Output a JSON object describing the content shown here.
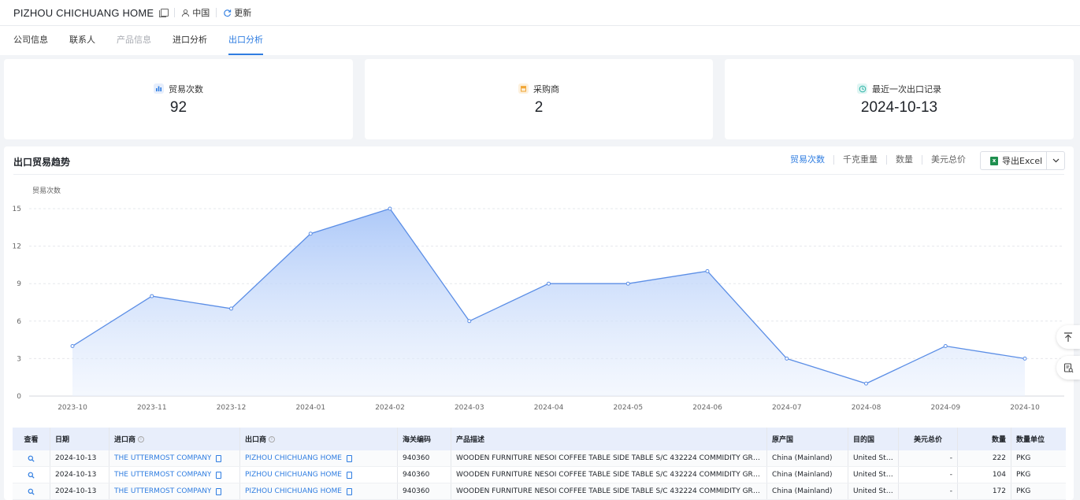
{
  "header": {
    "company_name": "PIZHOU CHICHUANG HOME",
    "region": "中国",
    "refresh_label": "更新"
  },
  "tabs": [
    {
      "label": "公司信息",
      "state": "normal"
    },
    {
      "label": "联系人",
      "state": "normal"
    },
    {
      "label": "产品信息",
      "state": "disabled"
    },
    {
      "label": "进口分析",
      "state": "normal"
    },
    {
      "label": "出口分析",
      "state": "active"
    }
  ],
  "stats": {
    "trade_count_label": "贸易次数",
    "trade_count_value": "92",
    "buyers_label": "采购商",
    "buyers_value": "2",
    "last_export_label": "最近一次出口记录",
    "last_export_value": "2024-10-13"
  },
  "trend_panel": {
    "title": "出口贸易趋势",
    "metrics": [
      "贸易次数",
      "千克重量",
      "数量",
      "美元总价"
    ],
    "active_metric": "贸易次数",
    "export_label": "导出Excel"
  },
  "chart_data": {
    "type": "area",
    "ylabel": "贸易次数",
    "ylim": [
      0,
      15
    ],
    "yticks": [
      0,
      3,
      6,
      9,
      12,
      15
    ],
    "grid": true,
    "categories": [
      "2023-10",
      "2023-11",
      "2023-12",
      "2024-01",
      "2024-02",
      "2024-03",
      "2024-04",
      "2024-05",
      "2024-06",
      "2024-07",
      "2024-08",
      "2024-09",
      "2024-10"
    ],
    "values": [
      4,
      8,
      7,
      13,
      15,
      6,
      9,
      9,
      10,
      3,
      1,
      4,
      3
    ],
    "line_color": "#5b8ee6",
    "fill_color": "#c7d9fb"
  },
  "table": {
    "columns": [
      "查看",
      "日期",
      "进口商",
      "出口商",
      "海关编码",
      "产品描述",
      "原产国",
      "目的国",
      "美元总价",
      "数量",
      "数量单位"
    ],
    "rows": [
      [
        "2024-10-13",
        "THE UTTERMOST COMPANY",
        "PIZHOU CHICHUANG HOME",
        "940360",
        "WOODEN FURNITURE NESOI COFFEE TABLE SIDE TABLE S/C 432224 COMMIDITY GROU...",
        "China (Mainland)",
        "United Stat...",
        "-",
        "222",
        "PKG"
      ],
      [
        "2024-10-13",
        "THE UTTERMOST COMPANY",
        "PIZHOU CHICHUANG HOME",
        "940360",
        "WOODEN FURNITURE NESOI COFFEE TABLE SIDE TABLE S/C 432224 COMMIDITY GROU...",
        "China (Mainland)",
        "United Stat...",
        "-",
        "104",
        "PKG"
      ],
      [
        "2024-10-13",
        "THE UTTERMOST COMPANY",
        "PIZHOU CHICHUANG HOME",
        "940360",
        "WOODEN FURNITURE NESOI COFFEE TABLE SIDE TABLE S/C 432224 COMMIDITY GROU...",
        "China (Mainland)",
        "United Stat...",
        "-",
        "172",
        "PKG"
      ]
    ]
  }
}
